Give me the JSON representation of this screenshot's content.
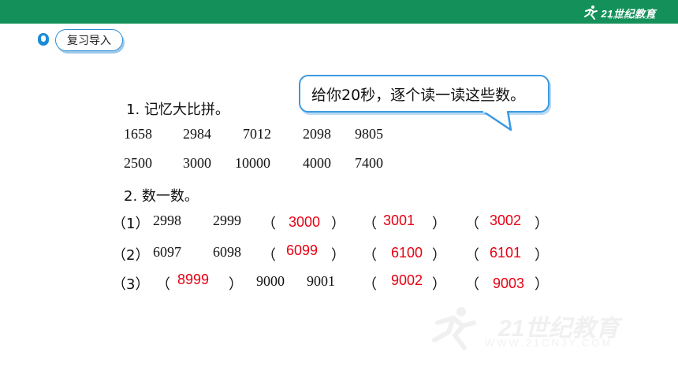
{
  "header": {
    "logo_text": "21世纪教育",
    "logo_sub": "WWW.21CNJY.COM"
  },
  "section": {
    "label": "复习导入"
  },
  "bubble": {
    "text": "给你20秒，逐个读一读这些数。"
  },
  "part1": {
    "title": "1. 记忆大比拼。",
    "row1": [
      "1658",
      "2984",
      "7012",
      "2098",
      "9805"
    ],
    "row2": [
      "2500",
      "3000",
      "10000",
      "4000",
      "7400"
    ]
  },
  "part2": {
    "title": "2. 数一数。",
    "q1": {
      "num": "（1）",
      "given": [
        "2998",
        "2999"
      ],
      "answers": [
        "3000",
        "3001",
        "3002"
      ]
    },
    "q2": {
      "num": "（2）",
      "given": [
        "6097",
        "6098"
      ],
      "answers": [
        "6099",
        "6100",
        "6101"
      ]
    },
    "q3": {
      "num": "（3）",
      "given": [
        "9000",
        "9001"
      ],
      "answers": [
        "8999",
        "9002",
        "9003"
      ]
    },
    "open": "（",
    "close": "）"
  },
  "watermark": {
    "text": "21世纪教育",
    "url": "WWW.21CNJY.COM"
  },
  "colors": {
    "header": "#14915a",
    "accent_blue": "#2f8fd6",
    "answer_red": "#e60012"
  }
}
